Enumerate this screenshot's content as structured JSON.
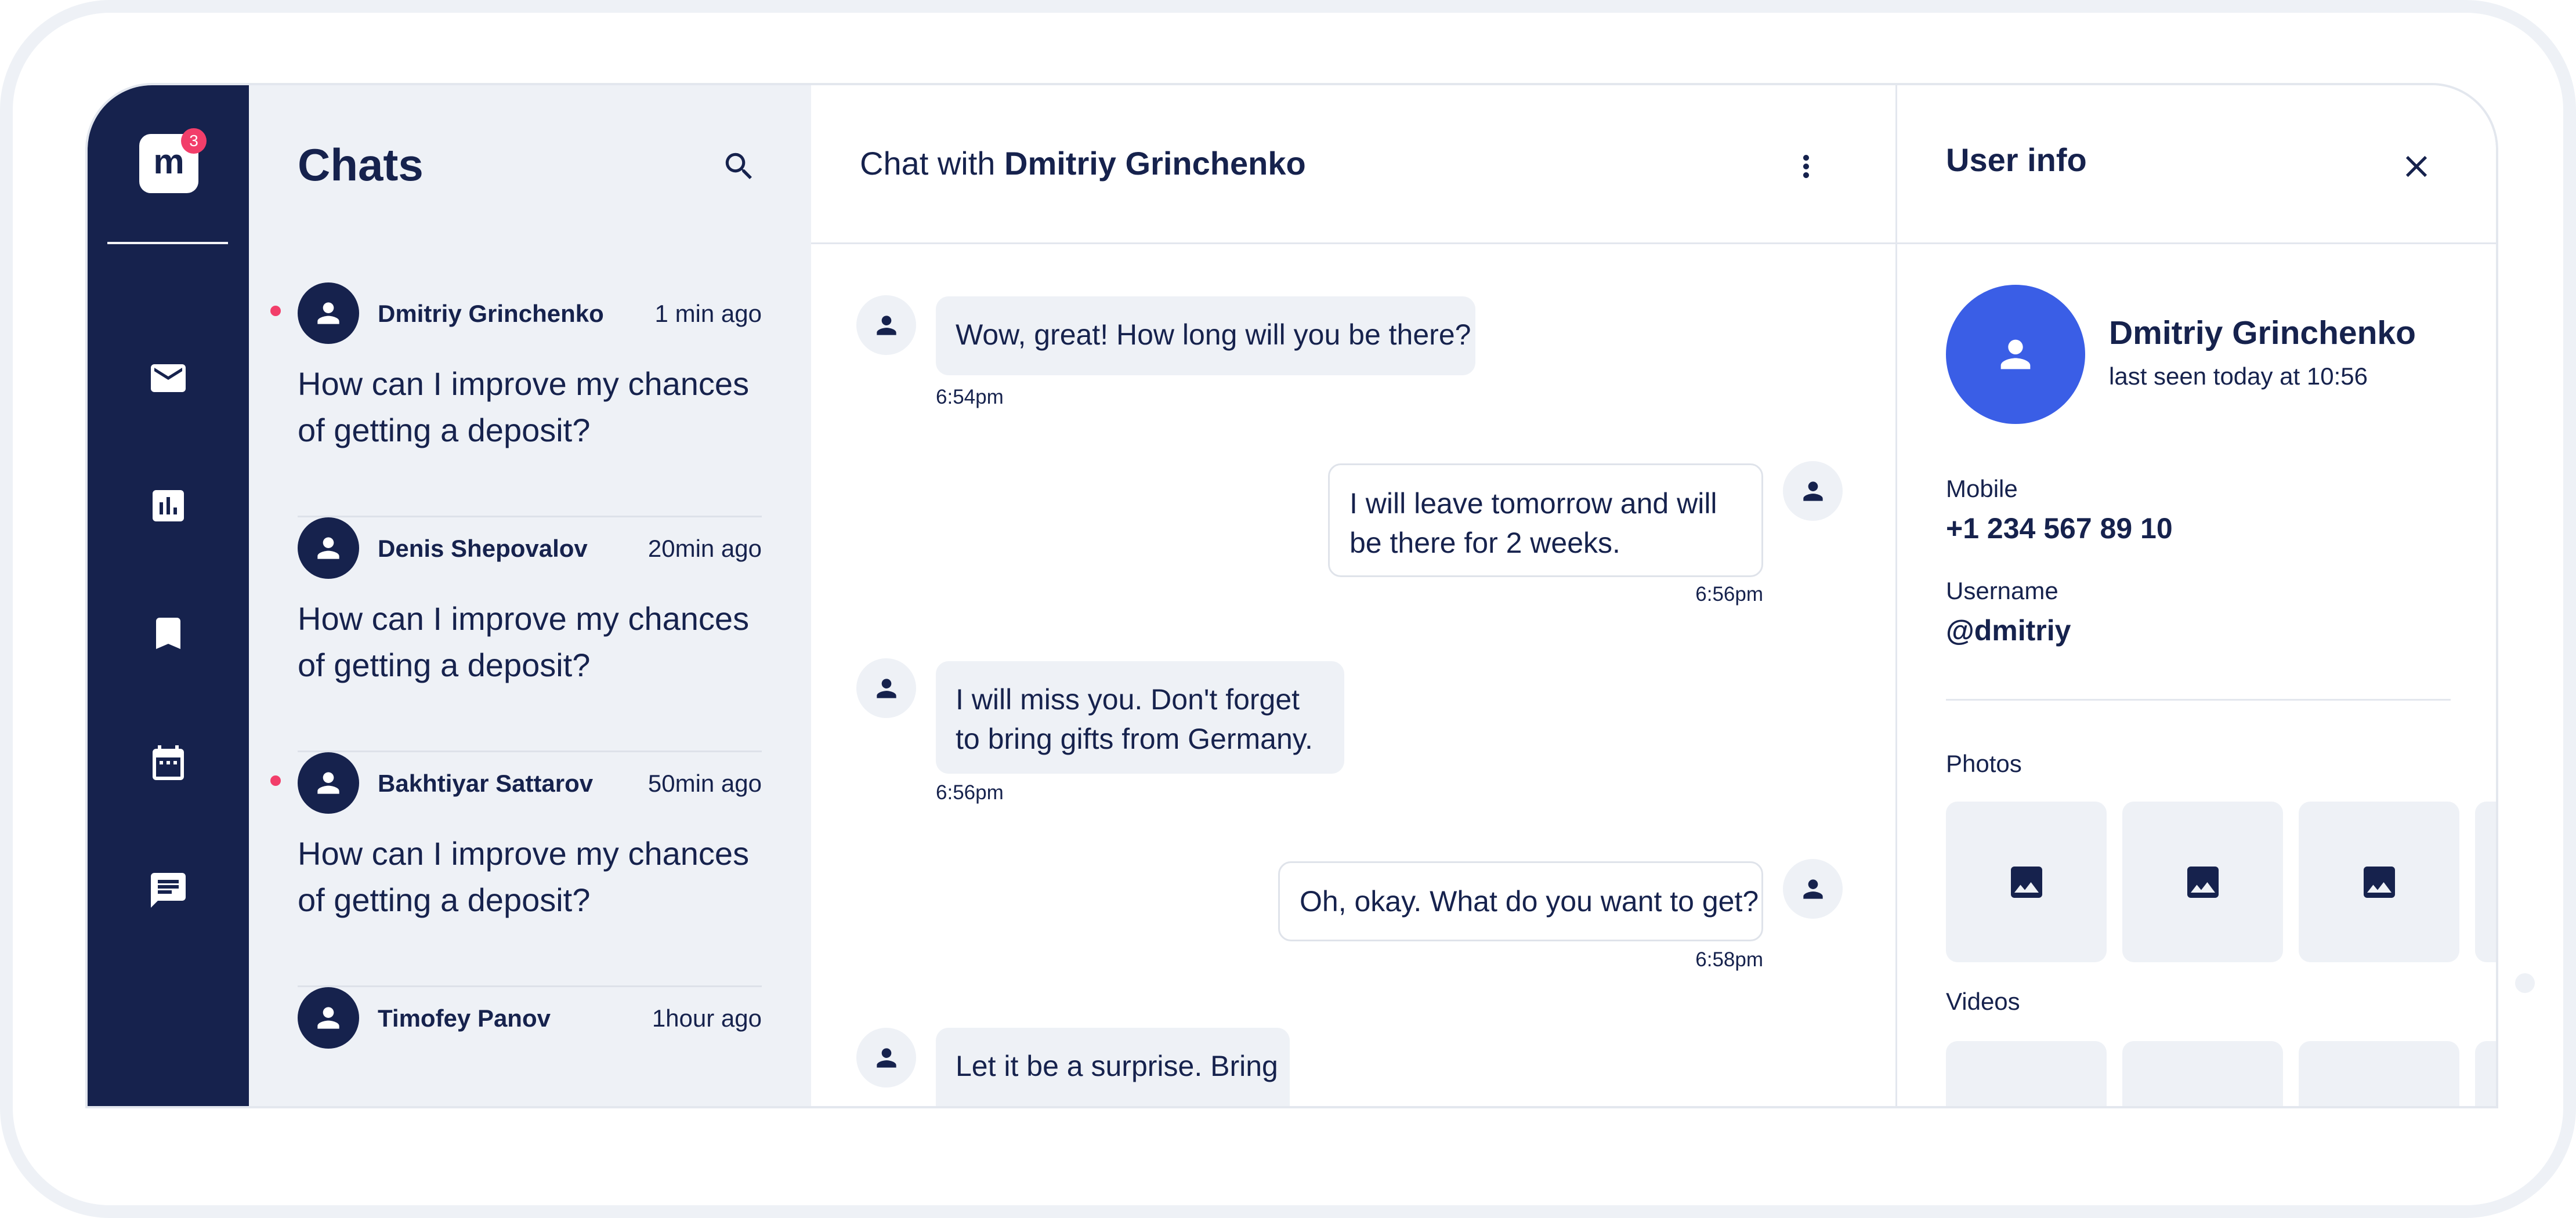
{
  "app": {
    "logo_letter": "m",
    "notification_count": "3",
    "nav_icons": [
      "mail-icon",
      "chart-icon",
      "bookmark-icon",
      "calendar-icon",
      "chat-icon"
    ]
  },
  "chat_list": {
    "title": "Chats",
    "items": [
      {
        "name": "Dmitriy Grinchenko",
        "time": "1 min ago",
        "preview": "How can I improve my chances of getting a deposit?",
        "unread": true
      },
      {
        "name": "Denis Shepovalov",
        "time": "20min ago",
        "preview": "How can I improve my chances of getting a deposit?",
        "unread": false
      },
      {
        "name": "Bakhtiyar Sattarov",
        "time": "50min ago",
        "preview": "How can I improve my chances of getting a deposit?",
        "unread": true
      },
      {
        "name": "Timofey Panov",
        "time": "1hour ago",
        "preview": "",
        "unread": false
      }
    ]
  },
  "chat": {
    "title_prefix": "Chat with",
    "title_name": "Dmitriy Grinchenko",
    "messages": [
      {
        "direction": "in",
        "text": "Wow, great! How long will you be there?",
        "time": "6:54pm"
      },
      {
        "direction": "out",
        "text": "I will leave tomorrow and will be there for 2 weeks.",
        "time": "6:56pm"
      },
      {
        "direction": "in",
        "text": "I will miss you. Don't forget to bring gifts from Germany.",
        "time": "6:56pm"
      },
      {
        "direction": "out",
        "text": "Oh, okay. What do you want to get?",
        "time": "6:58pm"
      },
      {
        "direction": "in",
        "text": "Let it be a surprise. Bring",
        "time": ""
      }
    ]
  },
  "user_info": {
    "title": "User info",
    "name": "Dmitriy Grinchenko",
    "status": "last seen today at 10:56",
    "mobile_label": "Mobile",
    "mobile_value": "+1 234 567 89 10",
    "username_label": "Username",
    "username_value": "@dmitriy",
    "photos_label": "Photos",
    "videos_label": "Videos"
  },
  "colors": {
    "navy": "#16224d",
    "panel_bg": "#eef1f6",
    "accent_blue": "#3a5ee6",
    "badge_red": "#f23e6a"
  }
}
